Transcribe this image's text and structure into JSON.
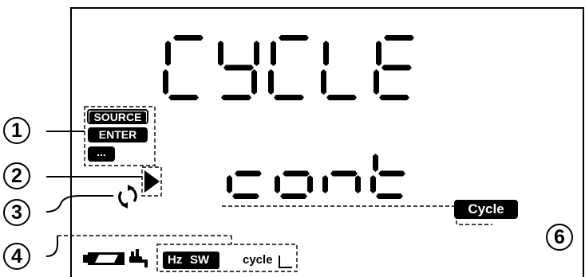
{
  "display": {
    "line1_text": "CYCLE",
    "line2_text": "cont"
  },
  "indicators": {
    "source_label": "SOURCE",
    "enter_label": "ENTER",
    "more_label": "...",
    "cycle_label": "Cycle",
    "hz_label": "Hz",
    "sw_label": "SW",
    "cycle_bar_label": "cycle",
    "play_icon": "play-triangle-icon",
    "repeat_icon": "repeat-cycle-icon",
    "battery_icon": "battery-icon",
    "plug_icon": "plug-icon"
  },
  "callouts": {
    "c1": "1",
    "c2": "2",
    "c3": "3",
    "c4": "4",
    "c6": "6"
  },
  "colors": {
    "segment": "#000000",
    "background": "#ffffff",
    "callout_line": "#000000"
  }
}
